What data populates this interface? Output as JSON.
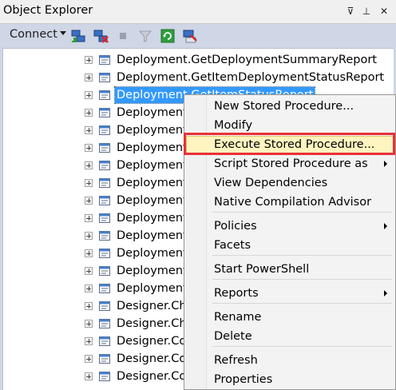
{
  "panel": {
    "title": "Object Explorer",
    "controls": {
      "pin": "⊽",
      "autohide": "⊥",
      "close": "✕"
    }
  },
  "toolbar": {
    "connect_label": "Connect",
    "icons": [
      "connect-object-explorer-icon",
      "disconnect-icon",
      "stop-icon",
      "filter-icon",
      "refresh-icon",
      "start-powershell-icon"
    ]
  },
  "tree": {
    "items": [
      {
        "label": "Deployment.GetDeploymentSummaryReport",
        "selected": false
      },
      {
        "label": "Deployment.GetItemDeploymentStatusReport",
        "selected": false
      },
      {
        "label": "Deployment.GetItemStatusReport",
        "selected": true
      },
      {
        "label": "Deployment.C",
        "selected": false
      },
      {
        "label": "Deployment.C",
        "selected": false
      },
      {
        "label": "Deployment.C",
        "selected": false
      },
      {
        "label": "Deployment.S",
        "selected": false
      },
      {
        "label": "Deployment.U",
        "selected": false
      },
      {
        "label": "Deployment.U",
        "selected": false
      },
      {
        "label": "Deployment.U",
        "selected": false
      },
      {
        "label": "Deployment.V",
        "selected": false
      },
      {
        "label": "Deployment.V",
        "selected": false
      },
      {
        "label": "Deployment.V",
        "selected": false
      },
      {
        "label": "Deployment.V",
        "selected": false
      },
      {
        "label": "Designer.Che",
        "selected": false
      },
      {
        "label": "Designer.Che",
        "selected": false
      },
      {
        "label": "Designer.Coll",
        "selected": false
      },
      {
        "label": "Designer.Coll",
        "selected": false
      },
      {
        "label": "Designer.Coll",
        "selected": false
      }
    ]
  },
  "context_menu": {
    "items": [
      {
        "label": "New Stored Procedure...",
        "submenu": false
      },
      {
        "label": "Modify",
        "submenu": false
      },
      {
        "label": "Execute Stored Procedure...",
        "submenu": false,
        "highlighted": true
      },
      {
        "label": "Script Stored Procedure as",
        "submenu": true
      },
      {
        "label": "View Dependencies",
        "submenu": false
      },
      {
        "label": "Native Compilation Advisor",
        "submenu": false
      },
      {
        "label": "Policies",
        "submenu": true
      },
      {
        "label": "Facets",
        "submenu": false
      },
      {
        "label": "Start PowerShell",
        "submenu": false
      },
      {
        "label": "Reports",
        "submenu": true
      },
      {
        "label": "Rename",
        "submenu": false
      },
      {
        "label": "Delete",
        "submenu": false
      },
      {
        "label": "Refresh",
        "submenu": false
      },
      {
        "label": "Properties",
        "submenu": false
      }
    ]
  },
  "colors": {
    "selection": "#3399ff",
    "highlight_fill": "#fdf4bf",
    "highlight_border": "#e5c365",
    "annotation_red": "#e8313a",
    "toolbar_bg": "#cfd6e5"
  }
}
